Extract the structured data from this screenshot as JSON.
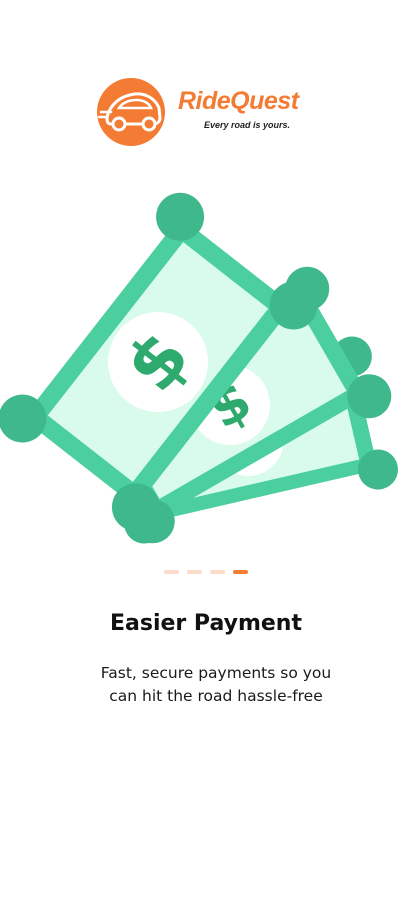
{
  "brand": {
    "name": "RideQuest",
    "tagline": "Every road is yours.",
    "accent_color": "#F47B33"
  },
  "illustration": {
    "icon": "money-bills-icon",
    "bill_color": "#4CCF9E",
    "bill_inner_color": "#D9FBEC"
  },
  "pager": {
    "total": 4,
    "active_index": 3
  },
  "onboarding": {
    "title": "Easier Payment",
    "description": "Fast, secure payments so you can hit the road hassle-free"
  }
}
